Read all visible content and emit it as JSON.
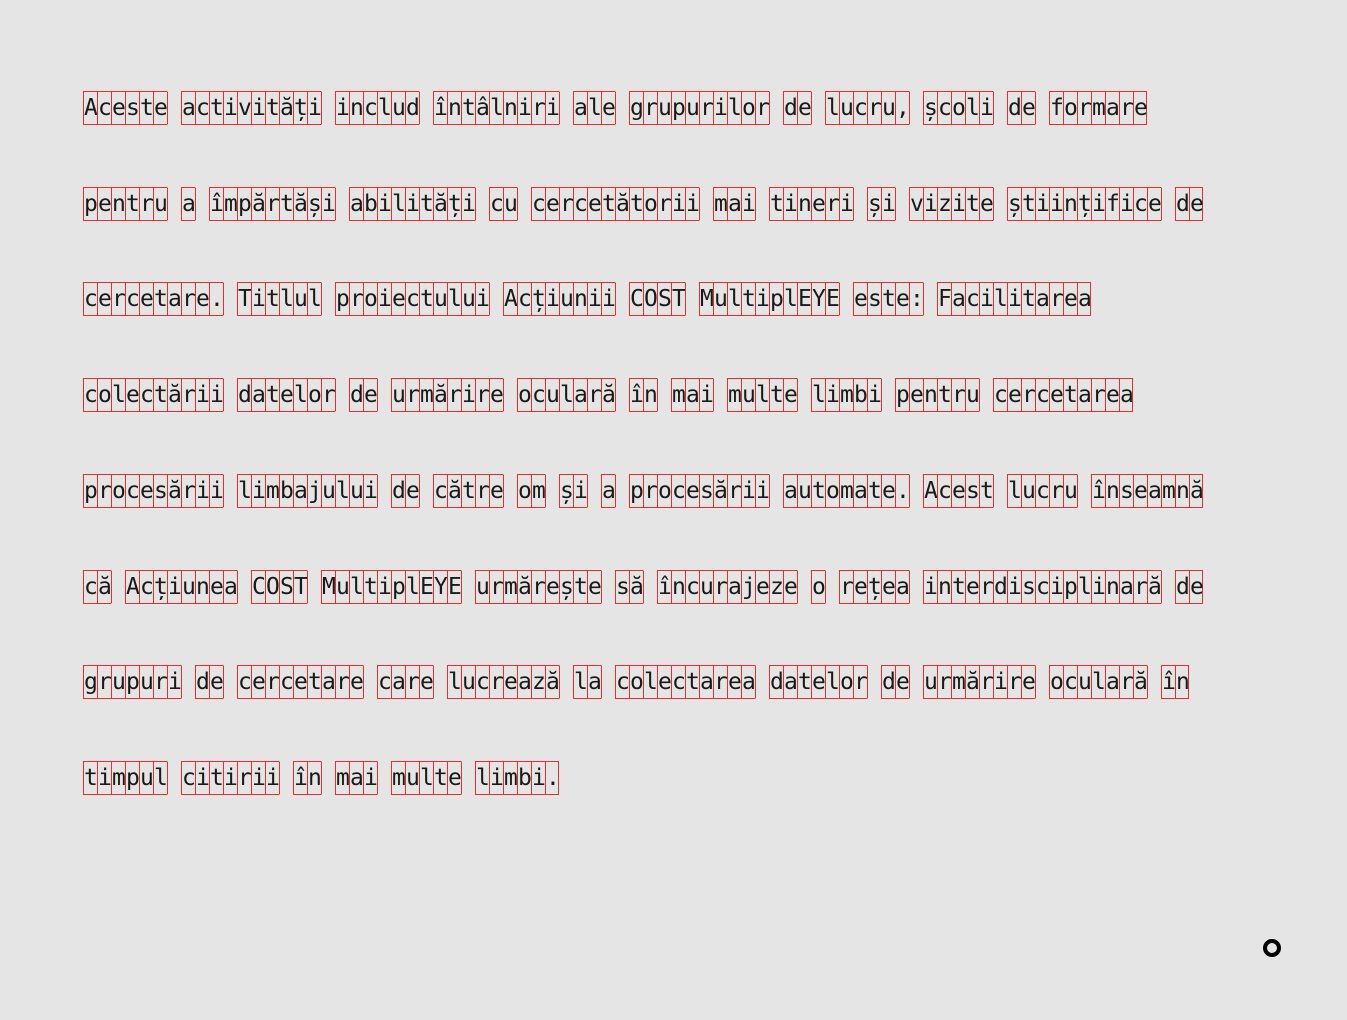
{
  "reading_text": {
    "lines": [
      "Aceste activități includ întâlniri ale grupurilor de lucru, școli de formare",
      "pentru a împărtăși abilități cu cercetătorii mai tineri și vizite științifice de",
      "cercetare. Titlul proiectului Acțiunii COST MultiplEYE este: Facilitarea",
      "colectării datelor de urmărire oculară în mai multe limbi pentru cercetarea",
      "procesării limbajului de către om și a procesării automate. Acest lucru înseamnă",
      "că Acțiunea COST MultiplEYE urmărește să încurajeze o rețea interdisciplinară de",
      "grupuri de cercetare care lucrează la colectarea datelor de urmărire oculară în",
      "timpul citirii în mai multe limbi."
    ]
  },
  "colors": {
    "background": "#e5e5e5",
    "char_box_border": "#e03030",
    "text": "#1a1a1a"
  },
  "cursor": {
    "icon": "ring-cursor-icon"
  }
}
